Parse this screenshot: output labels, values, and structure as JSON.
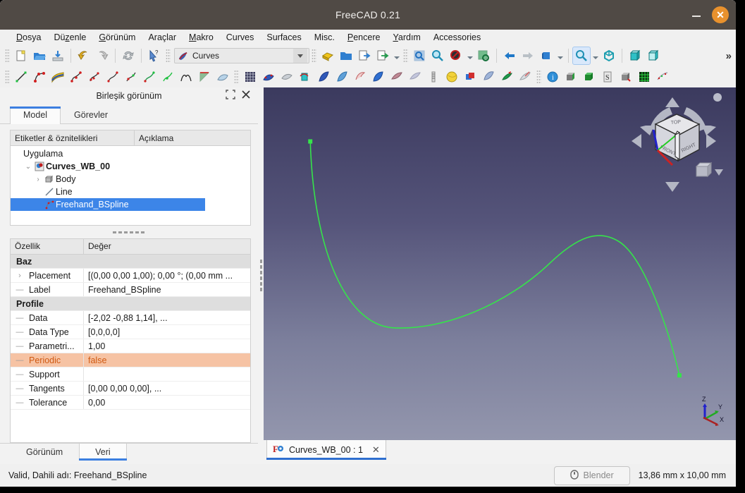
{
  "window": {
    "title": "FreeCAD 0.21",
    "minimize_label": "minimize",
    "close_label": "close"
  },
  "menubar": [
    {
      "label": "Dosya",
      "mnemonic": "D"
    },
    {
      "label": "Düzenle",
      "mnemonic": "z"
    },
    {
      "label": "Görünüm",
      "mnemonic": "G"
    },
    {
      "label": "Araçlar",
      "mnemonic": ""
    },
    {
      "label": "Makro",
      "mnemonic": "M"
    },
    {
      "label": "Curves",
      "mnemonic": ""
    },
    {
      "label": "Surfaces",
      "mnemonic": ""
    },
    {
      "label": "Misc.",
      "mnemonic": ""
    },
    {
      "label": "Pencere",
      "mnemonic": "P"
    },
    {
      "label": "Yardım",
      "mnemonic": "Y"
    },
    {
      "label": "Accessories",
      "mnemonic": ""
    }
  ],
  "toolbar": {
    "workbench_selected": "Curves",
    "row1_icons": [
      "new-document-icon",
      "open-document-icon",
      "save-document-icon",
      "undo-icon",
      "redo-icon",
      "refresh-icon",
      "whats-this-icon"
    ],
    "row1b_icons": [
      "create-part-icon",
      "create-group-icon",
      "import-icon",
      "export-icon",
      "std-view-fit-selection-icon",
      "std-view-fit-all-icon",
      "std-view-box-zoom-icon",
      "std-view-draw-style-icon",
      "view-back-icon",
      "view-forward-icon",
      "view-isometric-icon",
      "zoom-tool-icon",
      "view-axonometric-icon",
      "view-front-icon",
      "view-top-icon"
    ],
    "row2_icons": [
      "line-icon",
      "bspline-icon",
      "bezier-surface-icon",
      "interpolate-curve-icon",
      "approximate-curve-icon",
      "parametric-blend-curve-icon",
      "curve-extend-icon",
      "join-curve-icon",
      "split-curve-icon",
      "discretize-icon",
      "mixed-curve-icon",
      "sweep2rails-icon",
      "isocurves-icon",
      "profile-support-icon",
      "gordon-surface-icon",
      "pipeshell-icon",
      "blend-surface-icon",
      "sublink-icon",
      "segment-surface-icon",
      "flatten-face-icon",
      "reparametrize-icon",
      "curve-on-surface-icon",
      "trim-face-icon",
      "comp-info-icon",
      "solid-icon",
      "compound-filter-icon",
      "paste-icon",
      "extract-icon",
      "grid-icon",
      "point-cloud-icon"
    ],
    "overflow_label": "»"
  },
  "left_panel": {
    "header_title": "Birleşik görünüm",
    "header_icons": [
      "undock-icon",
      "close-icon"
    ],
    "tabs": [
      {
        "label": "Model",
        "active": true
      },
      {
        "label": "Görevler",
        "active": false
      }
    ],
    "tree": {
      "columns": [
        "Etiketler & öznitelikleri",
        "Açıklama"
      ],
      "rows": [
        {
          "label": "Uygulama",
          "depth": 0,
          "icon": "",
          "bold": false,
          "selected": false,
          "expander": ""
        },
        {
          "label": "Curves_WB_00",
          "depth": 1,
          "icon": "document-icon",
          "bold": true,
          "selected": false,
          "expander": "v"
        },
        {
          "label": "Body",
          "depth": 2,
          "icon": "body-icon",
          "bold": false,
          "selected": false,
          "expander": ">"
        },
        {
          "label": "Line",
          "depth": 2,
          "icon": "line-icon",
          "bold": false,
          "selected": false,
          "expander": ""
        },
        {
          "label": "Freehand_BSpline",
          "depth": 2,
          "icon": "bspline-icon",
          "bold": false,
          "selected": true,
          "expander": ""
        }
      ]
    },
    "properties": {
      "columns": [
        "Özellik",
        "Değer"
      ],
      "rows": [
        {
          "kind": "group",
          "name": "Baz",
          "value": ""
        },
        {
          "kind": "item",
          "name": "Placement",
          "value": "[(0,00 0,00 1,00); 0,00 °; (0,00 mm ...",
          "expander": ">",
          "highlight": false
        },
        {
          "kind": "item",
          "name": "Label",
          "value": "Freehand_BSpline",
          "expander": "",
          "highlight": false
        },
        {
          "kind": "group",
          "name": "Profile",
          "value": ""
        },
        {
          "kind": "item",
          "name": "Data",
          "value": "[-2,02 -0,88 1,14], ...",
          "expander": "",
          "highlight": false
        },
        {
          "kind": "item",
          "name": "Data Type",
          "value": "[0,0,0,0]",
          "expander": "",
          "highlight": false
        },
        {
          "kind": "item",
          "name": "Parametri...",
          "value": "1,00",
          "expander": "",
          "highlight": false
        },
        {
          "kind": "item",
          "name": "Periodic",
          "value": "false",
          "expander": "",
          "highlight": true
        },
        {
          "kind": "item",
          "name": "Support",
          "value": "",
          "expander": "",
          "highlight": false
        },
        {
          "kind": "item",
          "name": "Tangents",
          "value": "[0,00 0,00 0,00], ...",
          "expander": "",
          "highlight": false
        },
        {
          "kind": "item",
          "name": "Tolerance",
          "value": "0,00",
          "expander": "",
          "highlight": false
        }
      ]
    },
    "bottom_tabs": [
      {
        "label": "Görünüm",
        "active": false
      },
      {
        "label": "Veri",
        "active": true
      }
    ]
  },
  "view3d": {
    "navcube": {
      "top_face": "TOP",
      "front_face": "FRONT",
      "right_face": "RIGHT"
    },
    "axes": {
      "x": "X",
      "y": "Y",
      "z": "Z"
    },
    "curve_color": "#35e44a",
    "background_top": "#3b3a5e",
    "background_bottom": "#9396ad"
  },
  "document_tabs": [
    {
      "label": "Curves_WB_00 : 1",
      "icon": "freecad-doc-icon",
      "close": "✕",
      "active": true
    }
  ],
  "statusbar": {
    "message": "Valid, Dahili adı: Freehand_BSpline",
    "nav_style": "Blender",
    "nav_icon": "mouse-icon",
    "dimensions": "13,86 mm x 10,00 mm"
  }
}
